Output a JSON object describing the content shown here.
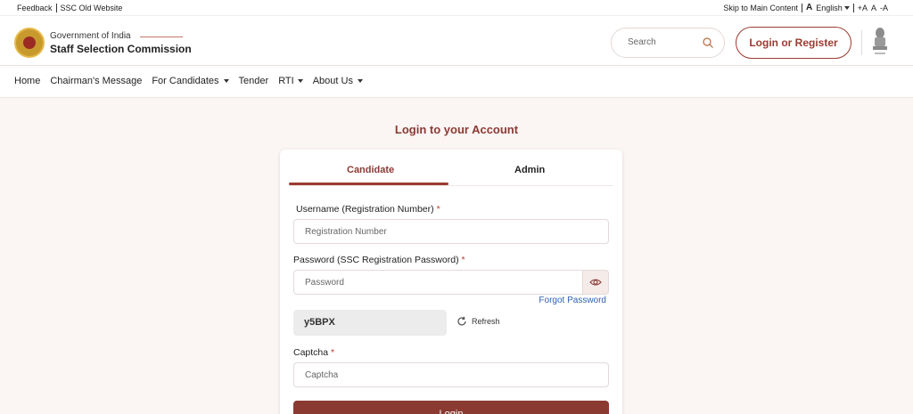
{
  "topbar": {
    "feedback": "Feedback",
    "old_site": "SSC Old Website",
    "skip": "Skip to Main Content",
    "lang_icon": "A",
    "language": "English",
    "font_plus": "+A",
    "font_normal": "A",
    "font_minus": "-A"
  },
  "header": {
    "gov": "Government of India",
    "org": "Staff Selection Commission",
    "search_placeholder": "Search",
    "login_register": "Login or Register"
  },
  "nav": {
    "items": [
      "Home",
      "Chairman's Message",
      "For Candidates",
      "Tender",
      "RTI",
      "About Us"
    ]
  },
  "main": {
    "title": "Login to your Account",
    "tabs": [
      "Candidate",
      "Admin"
    ],
    "username_label": "Username (Registration Number)",
    "username_placeholder": "Registration Number",
    "password_label": "Password (SSC Registration Password)",
    "password_placeholder": "Password",
    "forgot": "Forgot Password",
    "captcha_code": "y5BPX",
    "refresh": "Refresh",
    "captcha_label": "Captcha",
    "captcha_placeholder": "Captcha",
    "submit": "Login",
    "required_mark": "*"
  },
  "colors": {
    "accent": "#8b3a32",
    "link": "#2d5fb8",
    "background": "#fbf5f4"
  },
  "icons": [
    "search-icon",
    "eye-icon",
    "refresh-icon",
    "ssc-logo",
    "national-emblem"
  ]
}
